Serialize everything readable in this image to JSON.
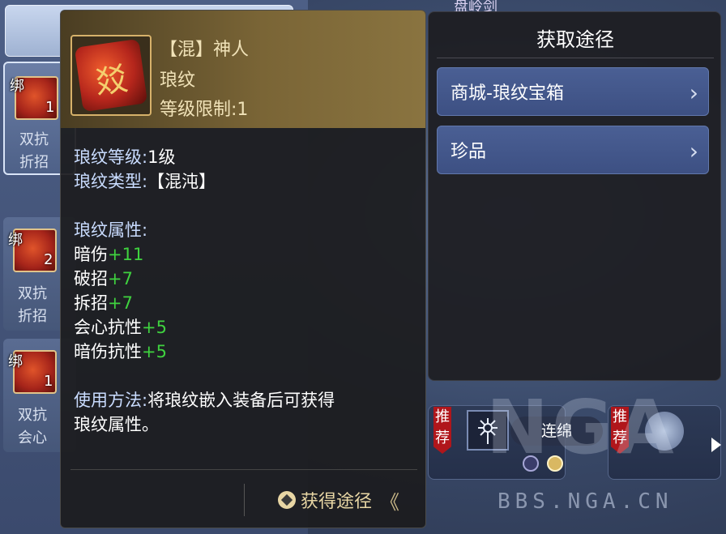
{
  "background": {
    "top_label": "盘岭剑",
    "list": [
      {
        "bind": "绑",
        "count": "1",
        "line1": "双抗",
        "line2": "折招"
      },
      {
        "bind": "绑",
        "count": "2",
        "line1": "双抗",
        "line2": "折招"
      },
      {
        "bind": "绑",
        "count": "1",
        "line1": "双抗",
        "line2": "会心"
      }
    ],
    "recommend_label": "推荐",
    "skill_label": "连绵",
    "watermark": "BBS.NGA.CN",
    "logo": "NGA"
  },
  "tooltip": {
    "item_icon": "rune-stone-icon",
    "rune_glyph": "㸚",
    "name": "【混】神人",
    "type": "琅纹",
    "level_req": "等级限制:1",
    "rune_level_label": "琅纹等级:",
    "rune_level_value": "1级",
    "rune_type_label": "琅纹类型:",
    "rune_type_value": "【混沌】",
    "attr_header": "琅纹属性:",
    "attributes": [
      {
        "name": "暗伤",
        "value": "+11"
      },
      {
        "name": "破招",
        "value": "+7"
      },
      {
        "name": "拆招",
        "value": "+7"
      },
      {
        "name": "会心抗性",
        "value": "+5"
      },
      {
        "name": "暗伤抗性",
        "value": "+5"
      }
    ],
    "usage_label": "使用方法:",
    "usage_text_1": "将琅纹嵌入装备后可获得",
    "usage_text_2": "琅纹属性。",
    "obtain_label": "获得途径",
    "obtain_chevron": "《"
  },
  "acquisition": {
    "title": "获取途径",
    "items": [
      {
        "label": "商城-琅纹宝箱",
        "chevron": "›"
      },
      {
        "label": "珍品",
        "chevron": "›"
      }
    ]
  },
  "colors": {
    "positive_value": "#3fd23f",
    "label_blue": "#c9dcff",
    "gold_text": "#f0e2b8",
    "recommend_red": "#b0161b"
  }
}
